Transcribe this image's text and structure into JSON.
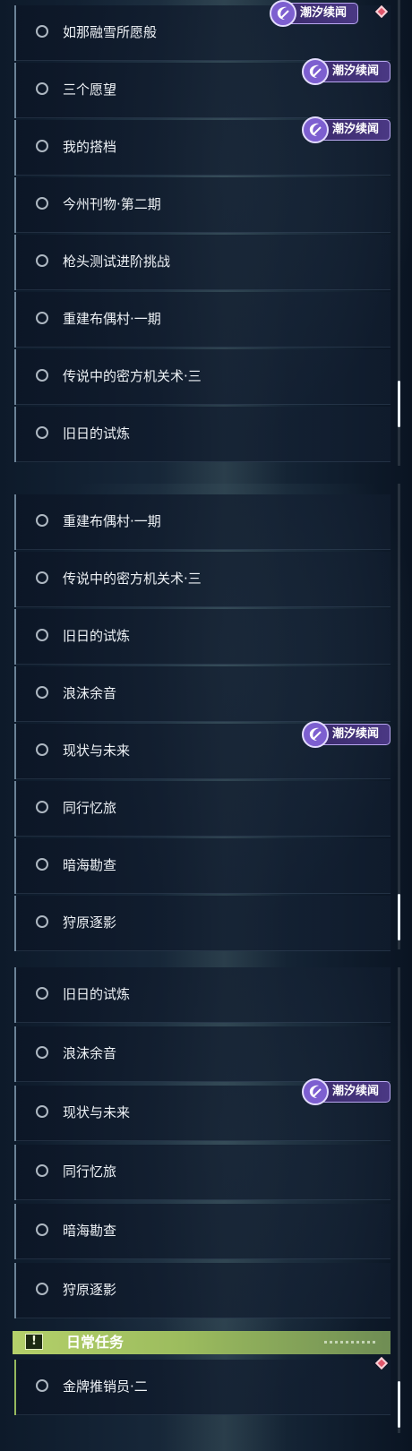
{
  "panels": [
    {
      "rows": [
        {
          "label": "如那融雪所愿般"
        },
        {
          "label": "三个愿望"
        },
        {
          "label": "我的搭档"
        },
        {
          "label": "今州刊物·第二期"
        },
        {
          "label": "枪头测试进阶挑战"
        },
        {
          "label": "重建布偶村·一期"
        },
        {
          "label": "传说中的密方机关术·三"
        },
        {
          "label": "旧日的试炼"
        }
      ],
      "tags": [
        {
          "label": "潮汐续闻"
        },
        {
          "label": "潮汐续闻"
        },
        {
          "label": "潮汐续闻"
        }
      ],
      "scroll_position": 0.62
    },
    {
      "rows": [
        {
          "label": "重建布偶村·一期"
        },
        {
          "label": "传说中的密方机关术·三"
        },
        {
          "label": "旧日的试炼"
        },
        {
          "label": "浪沫余音"
        },
        {
          "label": "现状与未来"
        },
        {
          "label": "同行忆旅"
        },
        {
          "label": "暗海勘查"
        },
        {
          "label": "狩原逐影"
        }
      ],
      "tags": [
        {
          "label": "潮汐续闻"
        }
      ],
      "scroll_position": 0.85
    },
    {
      "rows": [
        {
          "label": "旧日的试炼"
        },
        {
          "label": "浪沫余音"
        },
        {
          "label": "现状与未来"
        },
        {
          "label": "同行忆旅"
        },
        {
          "label": "暗海勘查"
        },
        {
          "label": "狩原逐影"
        }
      ],
      "tags": [
        {
          "label": "潮汐续闻"
        }
      ],
      "daily_section": {
        "title": "日常任务",
        "icon": "exclamation-icon",
        "icon_glyph": "!",
        "rows": [
          {
            "label": "金牌推销员·二"
          }
        ]
      },
      "scroll_position": 1.0
    }
  ],
  "colors": {
    "tag_bg": "#4a3884",
    "daily_header": "#b4d06a",
    "notification": "#e0566b"
  }
}
